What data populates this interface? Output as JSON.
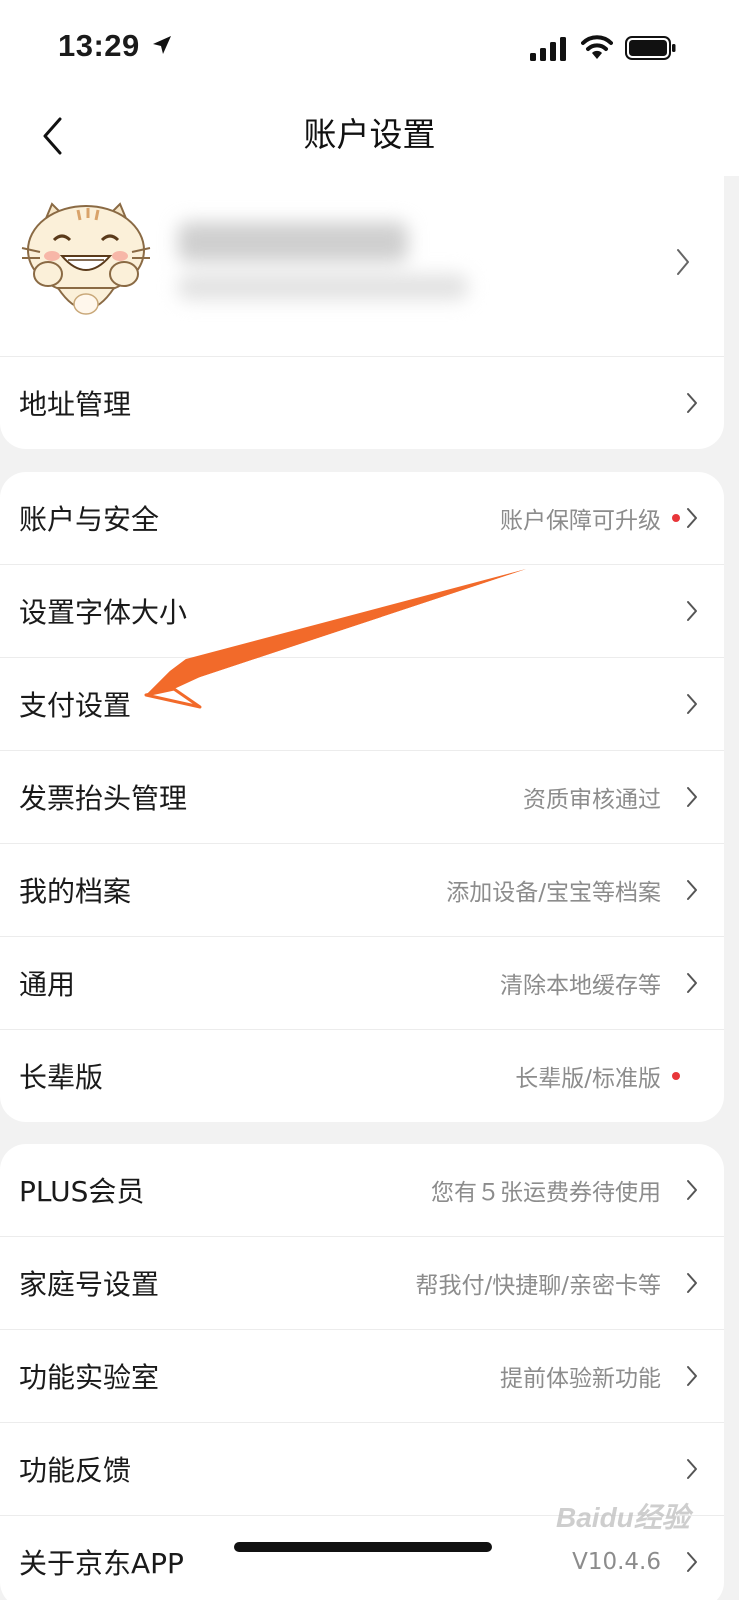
{
  "status_bar": {
    "time": "13:29"
  },
  "nav": {
    "title": "账户设置"
  },
  "profile": {
    "avatar_icon": "cartoon-cat-avatar"
  },
  "group1": {
    "items": [
      {
        "label": "地址管理",
        "sub": ""
      }
    ]
  },
  "group2": {
    "items": [
      {
        "label": "账户与安全",
        "sub": "账户保障可升级",
        "dot": true
      },
      {
        "label": "设置字体大小",
        "sub": ""
      },
      {
        "label": "支付设置",
        "sub": ""
      },
      {
        "label": "发票抬头管理",
        "sub": "资质审核通过"
      },
      {
        "label": "我的档案",
        "sub": "添加设备/宝宝等档案"
      },
      {
        "label": "通用",
        "sub": "清除本地缓存等"
      },
      {
        "label": "长辈版",
        "sub": "长辈版/标准版",
        "dot": true
      }
    ]
  },
  "group3": {
    "items": [
      {
        "label": "PLUS会员",
        "sub": "您有５张运费券待使用"
      },
      {
        "label": "家庭号设置",
        "sub": "帮我付/快捷聊/亲密卡等"
      },
      {
        "label": "功能实验室",
        "sub": "提前体验新功能"
      },
      {
        "label": "功能反馈",
        "sub": ""
      },
      {
        "label": "关于京东APP",
        "sub": "V10.4.6"
      }
    ]
  },
  "colors": {
    "accent_dot": "#e8363a",
    "annotation_arrow": "#f26a2a"
  },
  "watermark": "Baidu经验"
}
